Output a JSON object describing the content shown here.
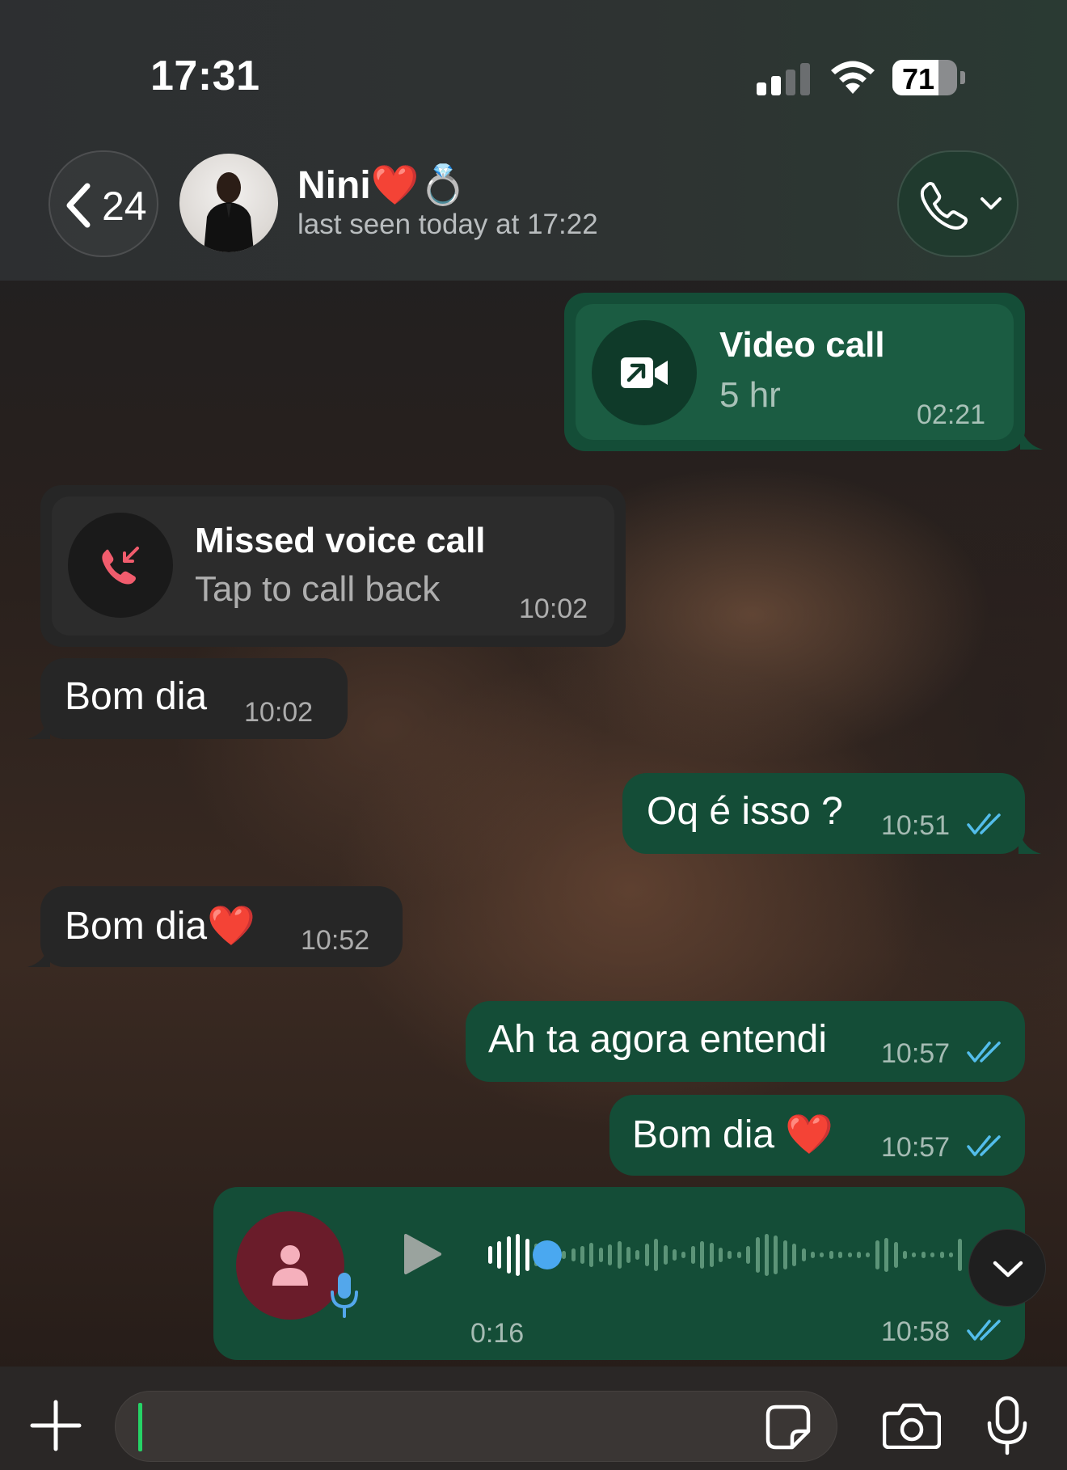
{
  "status_bar": {
    "time": "17:31",
    "battery": "71",
    "battery_level": 0.71
  },
  "header": {
    "back_count": "24",
    "contact_name": "Nini",
    "contact_emojis": "❤️💍",
    "last_seen": "last seen today at 17:22"
  },
  "messages": {
    "video_call": {
      "title": "Video call",
      "duration": "5 hr",
      "time": "02:21"
    },
    "missed_call": {
      "title": "Missed voice call",
      "subtitle": "Tap to call back",
      "time": "10:02"
    },
    "m1": {
      "text": "Bom dia",
      "time": "10:02"
    },
    "m2": {
      "text": "Oq é isso ?",
      "time": "10:51"
    },
    "m3": {
      "text": "Bom dia❤️",
      "time": "10:52"
    },
    "m4": {
      "text": "Ah ta agora entendi",
      "time": "10:57"
    },
    "m5": {
      "text": "Bom dia ❤️",
      "time": "10:57"
    },
    "voice": {
      "duration": "0:16",
      "time": "10:58",
      "progress": 0.1
    }
  },
  "colors": {
    "outgoing_bubble": "#144d37",
    "incoming_bubble": "#262626",
    "read_ticks": "#53bdeb",
    "missed_call_red": "#f15c6d",
    "caret_green": "#25d366"
  },
  "icons": [
    "chevron-left-icon",
    "phone-icon",
    "chevron-down-icon",
    "video-call-icon",
    "missed-call-icon",
    "play-icon",
    "person-icon",
    "microphone-icon",
    "plus-icon",
    "sticker-icon",
    "camera-icon",
    "double-check-icon"
  ]
}
